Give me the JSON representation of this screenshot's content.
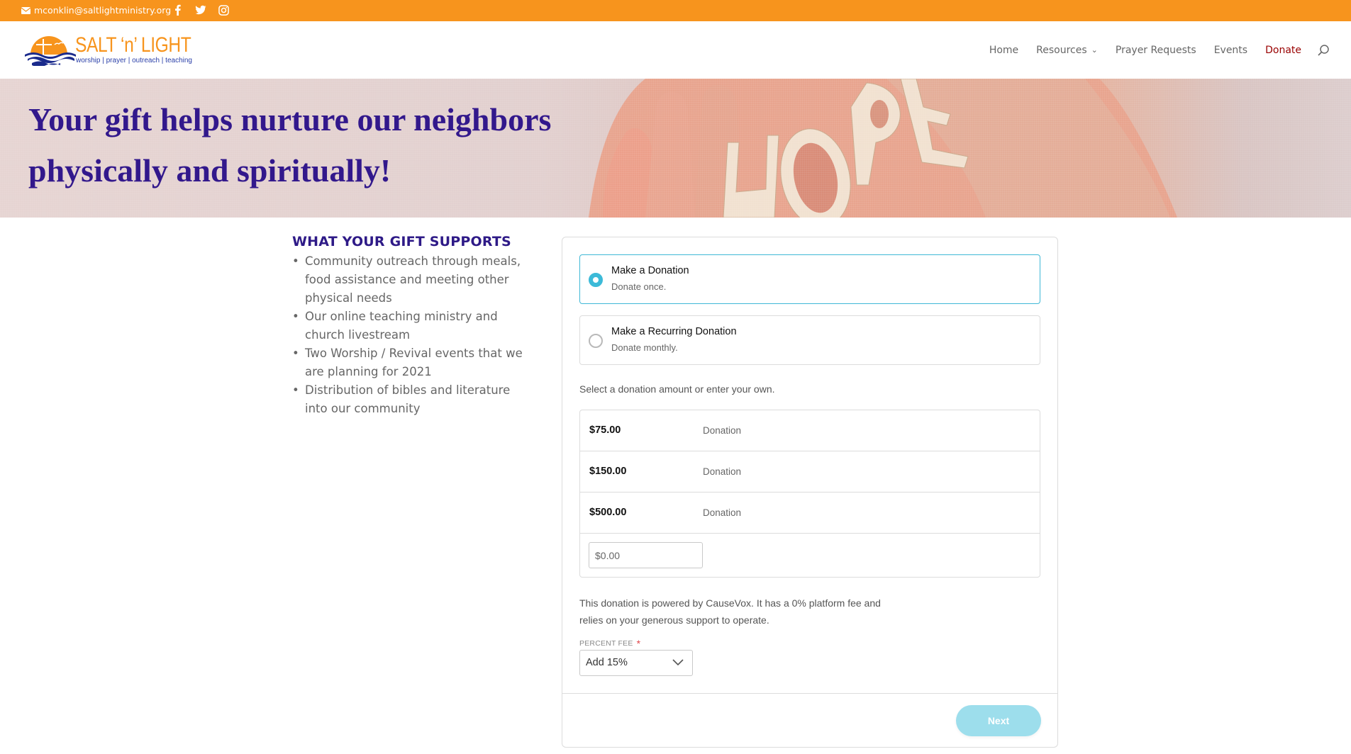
{
  "topbar": {
    "email": "mconklin@saltlightministry.org",
    "social": [
      {
        "name": "facebook",
        "icon": "facebook-icon"
      },
      {
        "name": "twitter",
        "icon": "twitter-icon"
      },
      {
        "name": "instagram",
        "icon": "instagram-icon"
      }
    ],
    "background": "#f7941d"
  },
  "header": {
    "logo": {
      "brand": "SALT ‘n’ LIGHT",
      "tagline": "worship | prayer | outreach | teaching"
    },
    "nav": [
      {
        "label": "Home",
        "active": false
      },
      {
        "label": "Resources",
        "has_dropdown": true,
        "active": false
      },
      {
        "label": "Prayer Requests",
        "active": false
      },
      {
        "label": "Events",
        "active": false
      },
      {
        "label": "Donate",
        "active": true
      }
    ],
    "search_icon": "search-icon",
    "active_color": "#990000"
  },
  "hero": {
    "headline": "Your gift helps nurture our neighbors physically and spiritually!",
    "image_text": "HOPE",
    "headline_color": "#32188c"
  },
  "supports": {
    "heading": "WHAT YOUR GIFT SUPPORTS",
    "items": [
      "Community outreach through meals, food assistance and meeting other physical needs",
      "Our online teaching ministry and church livestream",
      "Two Worship / Revival events that we are planning for 2021",
      "Distribution of bibles and literature into our community"
    ]
  },
  "donation_form": {
    "options": [
      {
        "title": "Make a Donation",
        "subtitle": "Donate once.",
        "selected": true
      },
      {
        "title": "Make a Recurring Donation",
        "subtitle": "Donate monthly.",
        "selected": false
      }
    ],
    "prompt": "Select a donation amount or enter your own.",
    "amounts": [
      {
        "value": "$75.00",
        "label": "Donation"
      },
      {
        "value": "$150.00",
        "label": "Donation"
      },
      {
        "value": "$500.00",
        "label": "Donation"
      }
    ],
    "custom_amount": {
      "value": "",
      "placeholder": "$0.00"
    },
    "note": "This donation is powered by CauseVox. It has a 0% platform fee and relies on your generous support to operate.",
    "fee": {
      "label": "PERCENT FEE",
      "required_mark": "*",
      "selected": "Add 15%"
    },
    "next_label": "Next",
    "accent_color": "#3cbad8"
  }
}
